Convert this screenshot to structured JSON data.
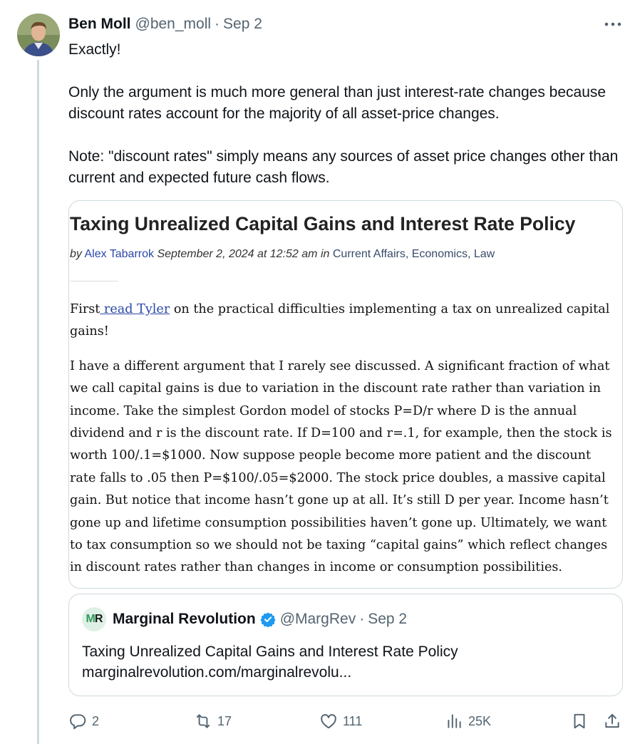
{
  "tweet": {
    "author_name": "Ben Moll",
    "author_handle": "@ben_moll",
    "separator": "·",
    "date": "Sep 2",
    "paragraphs": [
      "Exactly!",
      "Only the argument is much more general than just interest-rate changes because discount rates account for the majority of all asset-price changes.",
      "Note: \"discount rates\" simply means any sources of asset price changes other than current and expected future cash flows."
    ]
  },
  "article": {
    "title": "Taxing Unrealized Capital Gains and Interest Rate Policy",
    "by": "by",
    "author": "Alex Tabarrok",
    "datetime": "September 2, 2024 at 12:52 am",
    "in": "in",
    "categories": "Current Affairs, Economics, Law",
    "p1_before": "First",
    "p1_link": " read Tyler",
    "p1_after": " on the practical difficulties implementing a tax on unrealized capital gains!",
    "p2": "I have a different argument that I rarely see discussed. A significant fraction of what we call capital gains is due to variation in the discount rate rather than variation in income. Take the simplest Gordon model of stocks P=D/r where D is the annual dividend and r is the discount rate. If D=100 and r=.1, for example, then the stock is worth 100/.1=$1000. Now suppose people become more patient and the discount rate falls to .05 then P=$100/.05=$2000. The stock price doubles, a massive capital gain. But notice that income hasn’t gone up at all. It’s still D per year. Income hasn’t gone up and lifetime consumption possibilities haven’t gone up. Ultimately, we want to tax consumption so we should not be taxing “capital gains” which reflect changes in discount rates rather than changes in income or consumption possibilities."
  },
  "quote": {
    "logo_m": "M",
    "logo_r": "R",
    "name": "Marginal Revolution",
    "handle": "@MargRev",
    "separator": "·",
    "date": "Sep 2",
    "title": "Taxing Unrealized Capital Gains and Interest Rate Policy",
    "url": "marginalrevolution.com/marginalrevolu..."
  },
  "actions": {
    "replies": "2",
    "reposts": "17",
    "likes": "111",
    "views": "25K"
  },
  "colors": {
    "accent": "#1d9bf0",
    "muted": "#536471",
    "link": "#2b48a8"
  }
}
